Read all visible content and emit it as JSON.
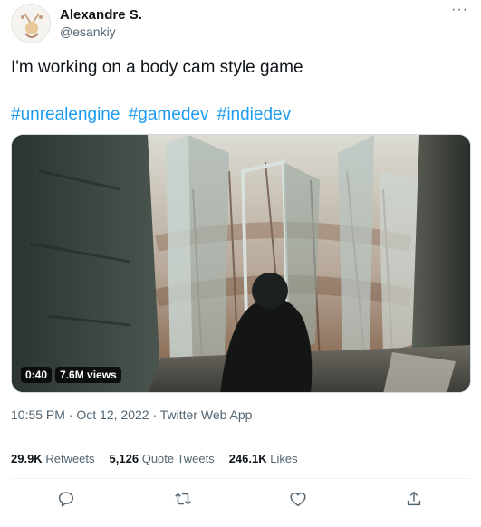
{
  "author": {
    "name": "Alexandre S.",
    "handle": "@esankiy",
    "more_label": "···"
  },
  "tweet": {
    "text": "I'm working on a body cam style game",
    "hashtags": [
      "#unrealengine",
      "#gamedev",
      "#indiedev"
    ]
  },
  "media": {
    "duration": "0:40",
    "views": "7.6M views"
  },
  "meta": {
    "time": "10:55 PM",
    "separator1": " · ",
    "date": "Oct 12, 2022",
    "separator2": " · ",
    "source": "Twitter Web App"
  },
  "stats": {
    "retweets_value": "29.9K",
    "retweets_label": "Retweets",
    "quotes_value": "5,126",
    "quotes_label": "Quote Tweets",
    "likes_value": "246.1K",
    "likes_label": "Likes"
  },
  "colors": {
    "accent": "#1d9bf0",
    "text": "#0f1419",
    "secondary": "#536471"
  },
  "icons": [
    "reply-icon",
    "retweet-icon",
    "like-icon",
    "share-icon"
  ]
}
